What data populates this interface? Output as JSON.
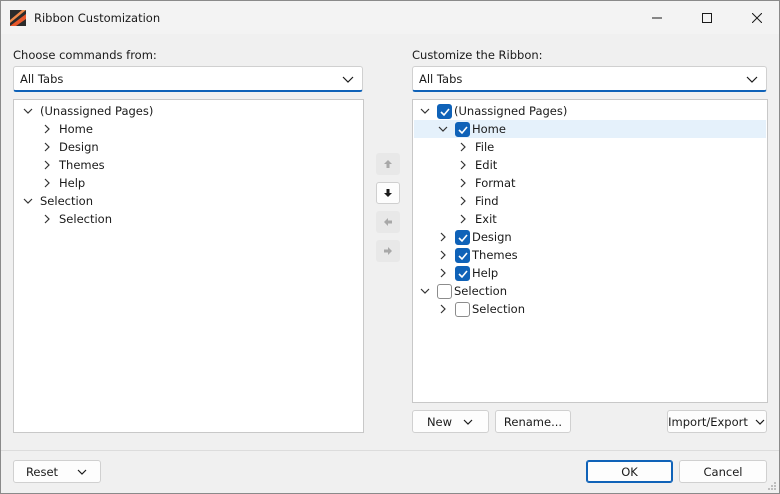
{
  "window": {
    "title": "Ribbon Customization",
    "controls": {
      "minimize": "minimize-icon",
      "maximize": "maximize-icon",
      "close": "close-icon"
    }
  },
  "left": {
    "label": "Choose commands from:",
    "combo_value": "All Tabs",
    "tree": [
      {
        "text": "(Unassigned Pages)",
        "expanded": true
      },
      {
        "text": "Home"
      },
      {
        "text": "Design"
      },
      {
        "text": "Themes"
      },
      {
        "text": "Help"
      },
      {
        "text": "Selection",
        "expanded": true
      },
      {
        "text": "Selection"
      }
    ]
  },
  "right": {
    "label": "Customize the Ribbon:",
    "combo_value": "All Tabs",
    "tree": [
      {
        "text": "(Unassigned Pages)",
        "expanded": true,
        "checked": true
      },
      {
        "text": "Home",
        "expanded": true,
        "checked": true,
        "selected": true
      },
      {
        "text": "File"
      },
      {
        "text": "Edit"
      },
      {
        "text": "Format"
      },
      {
        "text": "Find"
      },
      {
        "text": "Exit"
      },
      {
        "text": "Design",
        "checked": true
      },
      {
        "text": "Themes",
        "checked": true
      },
      {
        "text": "Help",
        "checked": true
      },
      {
        "text": "Selection",
        "expanded": true,
        "checked": false
      },
      {
        "text": "Selection",
        "checked": false
      }
    ],
    "buttons": {
      "new": "New",
      "rename": "Rename...",
      "import_export": "Import/Export"
    }
  },
  "move_buttons": [
    {
      "icon": "arrow-up-icon",
      "enabled": false
    },
    {
      "icon": "arrow-down-icon",
      "enabled": true
    },
    {
      "icon": "arrow-left-icon",
      "enabled": false
    },
    {
      "icon": "arrow-right-icon",
      "enabled": false
    }
  ],
  "footer": {
    "reset": "Reset",
    "ok": "OK",
    "cancel": "Cancel"
  },
  "colors": {
    "accent": "#0f62b8",
    "selection": "#e5f1fb"
  }
}
